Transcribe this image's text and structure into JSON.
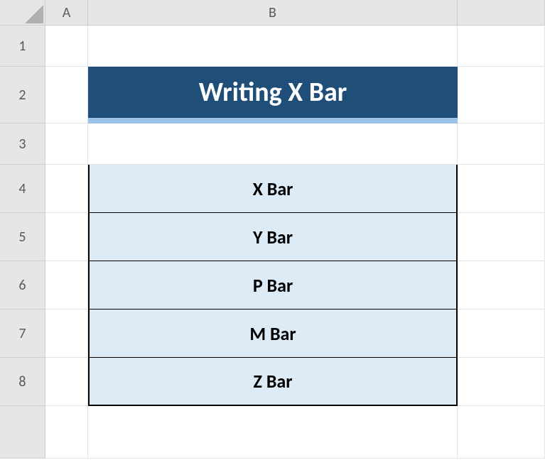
{
  "columns": {
    "A": "A",
    "B": "B"
  },
  "rows": {
    "1": "1",
    "2": "2",
    "3": "3",
    "4": "4",
    "5": "5",
    "6": "6",
    "7": "7",
    "8": "8"
  },
  "title": "Writing X Bar",
  "items": [
    "X Bar",
    "Y Bar",
    "P Bar",
    "M Bar",
    "Z Bar"
  ]
}
